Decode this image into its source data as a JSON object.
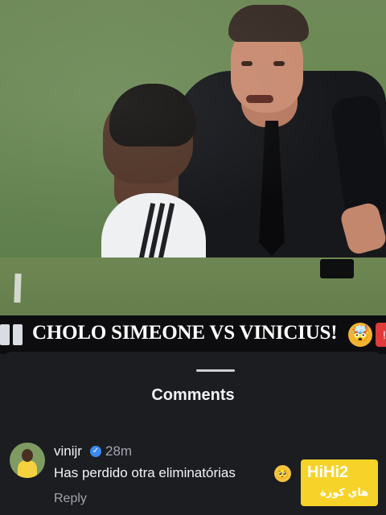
{
  "photo": {
    "headline": "CHOLO SIMEONE VS VINICIUS!",
    "headline_emoji": "exploding-head",
    "headline_emoji_glyph": "🤯"
  },
  "comments_sheet": {
    "title": "Comments",
    "comment": {
      "username": "vinijr",
      "verified": true,
      "timestamp": "28m",
      "text": "Has perdido otra eliminatórias",
      "emoji": "pleading-face",
      "emoji_glyph": "🥺",
      "reply_label": "Reply"
    }
  },
  "watermark": {
    "logo": "HiHi2",
    "subtitle": "هاي كورة"
  },
  "colors": {
    "background": "#1c1d21",
    "verified_badge": "#3a8bf0",
    "watermark": "#f6d329",
    "banner": "#0d0d10"
  }
}
